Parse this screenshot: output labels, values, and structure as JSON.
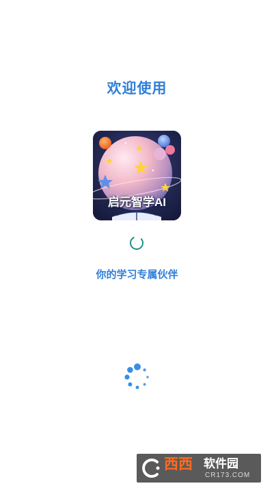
{
  "splash": {
    "welcome": "欢迎使用",
    "app_name": "启元智学AI",
    "tagline": "你的学习专属伙伴"
  },
  "watermark": {
    "brand": "西西",
    "label": "软件园",
    "domain": "CR173.COM"
  },
  "colors": {
    "accent": "#2f7fd8",
    "spinner_teal": "#1f8f86",
    "loader_blue": "#3a8ee6"
  },
  "icons": {
    "app_icon": "app-icon",
    "loading": "loading-spinner-icon",
    "loading_dots": "loading-dots-icon",
    "watermark_logo": "watermark-logo-icon"
  }
}
